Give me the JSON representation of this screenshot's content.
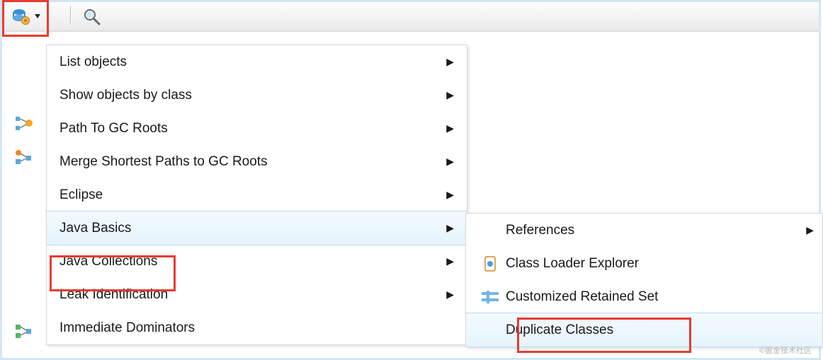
{
  "toolbar": {
    "query_icon": "query-browser-icon",
    "dropdown_icon": "dropdown-icon",
    "search_icon": "search-icon"
  },
  "side_icons": {
    "path_gc": "path-to-gc-roots-icon",
    "merge_paths": "merge-paths-icon",
    "dominators": "dominator-tree-icon"
  },
  "menu": {
    "items": [
      {
        "label": "List objects",
        "submenu": true
      },
      {
        "label": "Show objects by class",
        "submenu": true
      },
      {
        "label": "Path To GC Roots",
        "submenu": true
      },
      {
        "label": "Merge Shortest Paths to GC Roots",
        "submenu": true
      },
      {
        "label": "Eclipse",
        "submenu": true
      },
      {
        "label": "Java Basics",
        "submenu": true,
        "selected": true
      },
      {
        "label": "Java Collections",
        "submenu": true
      },
      {
        "label": "Leak Identification",
        "submenu": true
      },
      {
        "label": "Immediate Dominators",
        "submenu": false
      }
    ]
  },
  "submenu": {
    "items": [
      {
        "label": "References",
        "submenu": true,
        "icon": ""
      },
      {
        "label": "Class Loader Explorer",
        "submenu": false,
        "icon": "classloader-icon"
      },
      {
        "label": "Customized Retained Set",
        "submenu": false,
        "icon": "retained-set-icon"
      },
      {
        "label": "Duplicate Classes",
        "submenu": false,
        "icon": "",
        "selected": true
      }
    ]
  },
  "watermark": "©掘金技术社区"
}
